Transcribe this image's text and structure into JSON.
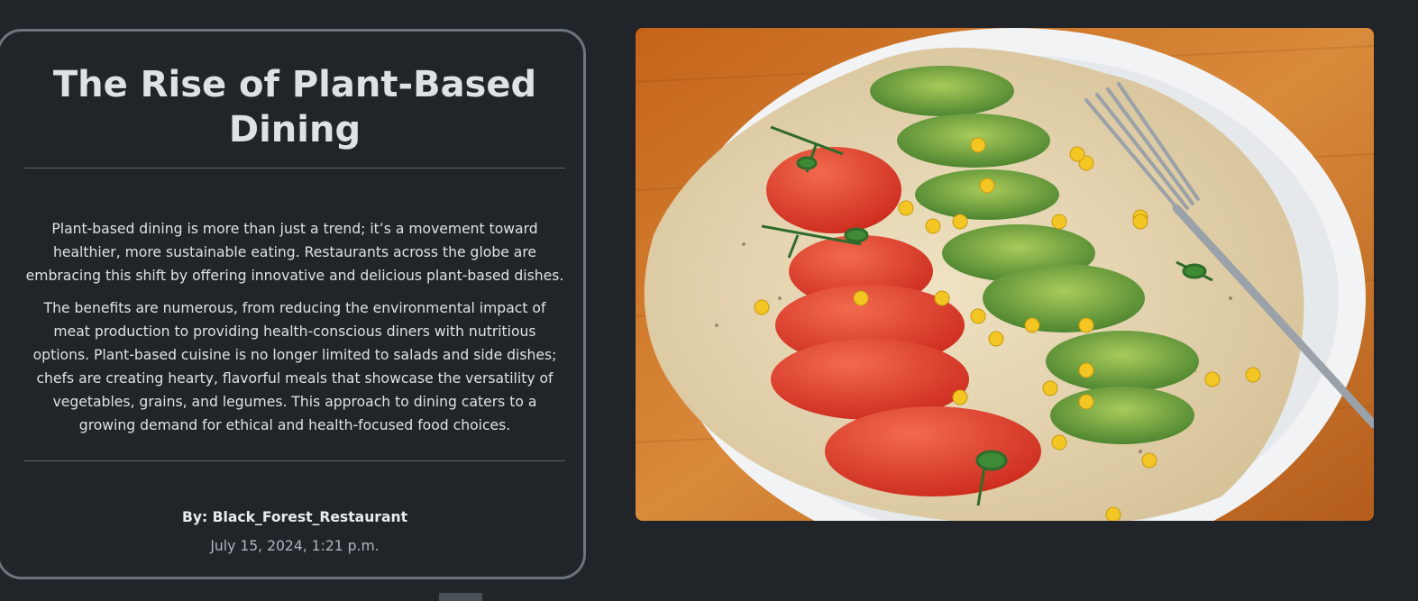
{
  "article": {
    "title": "The Rise of Plant-Based Dining",
    "paragraphs": [
      "Plant-based dining is more than just a trend; it’s a movement toward healthier, more sustainable eating. Restaurants across the globe are embracing this shift by offering innovative and delicious plant-based dishes.",
      "The benefits are numerous, from reducing the environmental impact of meat production to providing health-conscious diners with nutritious options. Plant-based cuisine is no longer limited to salads and side dishes; chefs are creating hearty, flavorful meals that showcase the versatility of vegetables, grains, and legumes. This approach to dining caters to a growing demand for ethical and health-focused food choices."
    ],
    "author": "By: Black_Forest_Restaurant",
    "date": "July 15, 2024, 1:21 p.m."
  },
  "image": {
    "content": "plate of tortilla with tomato, avocado, corn and herbs with a fork"
  },
  "colors": {
    "background": "#212529",
    "card_border": "#6c757d",
    "text": "#dee2e6",
    "muted_text": "#adb5bd"
  }
}
